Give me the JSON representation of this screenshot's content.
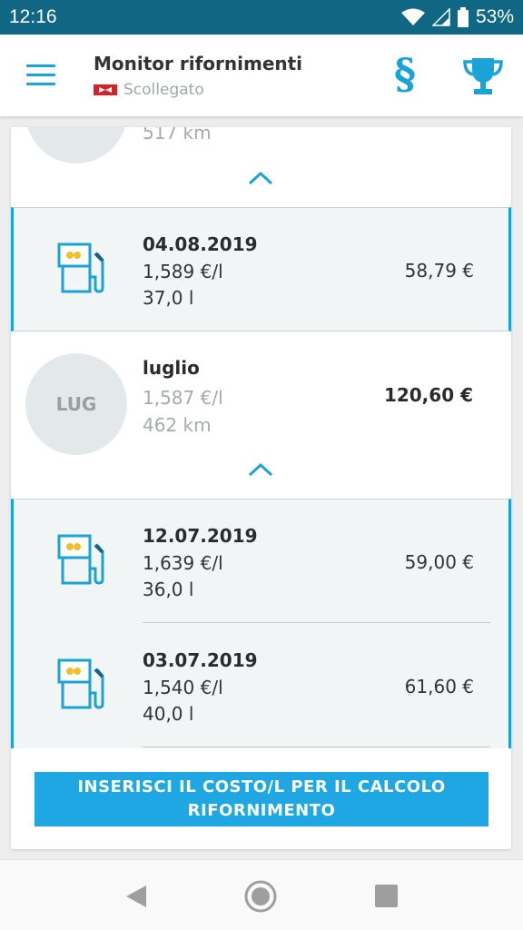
{
  "status_bar": {
    "time": "12:16",
    "battery": "53%"
  },
  "app_bar": {
    "title": "Monitor rifornimenti",
    "connection_status": "Scollegato",
    "icons": [
      "menu-icon",
      "section-sign-icon",
      "trophy-icon"
    ],
    "law_symbol": "§"
  },
  "month_prev": {
    "distance": "517 km"
  },
  "group_aug": [
    {
      "date": "04.08.2019",
      "price_per_liter": "1,589 €/l",
      "liters": "37,0 l",
      "cost": "58,79 €"
    }
  ],
  "month_jul": {
    "abbr": "LUG",
    "name": "luglio",
    "avg_price": "1,587 €/l",
    "distance": "462 km",
    "total": "120,60 €"
  },
  "group_jul": [
    {
      "date": "12.07.2019",
      "price_per_liter": "1,639 €/l",
      "liters": "36,0 l",
      "cost": "59,00 €"
    },
    {
      "date": "03.07.2019",
      "price_per_liter": "1,540 €/l",
      "liters": "40,0 l",
      "cost": "61,60 €"
    }
  ],
  "cta": {
    "label": "INSERISCI IL COSTO/L PER IL CALCOLO RIFORNIMENTO"
  },
  "colors": {
    "accent": "#1aa3d6",
    "status_bar": "#0f6783",
    "fuel_drop": "#f0c02c"
  }
}
